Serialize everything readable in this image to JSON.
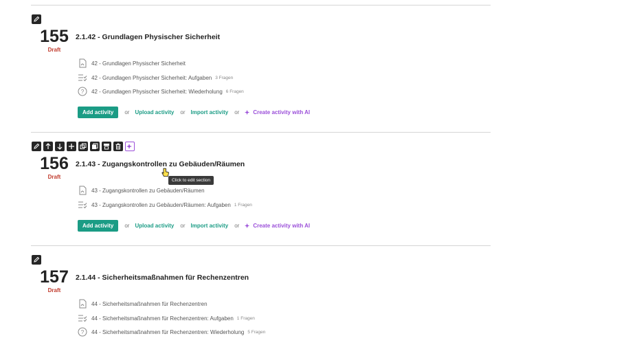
{
  "sections": [
    {
      "number": "155",
      "status": "Draft",
      "title": "2.1.42 - Grundlagen Physischer Sicherheit",
      "activities": [
        {
          "icon": "pdf-icon",
          "label": "42 - Grundlagen Physischer Sicherheit",
          "meta": ""
        },
        {
          "icon": "task-list-icon",
          "label": "42 - Grundlagen Physischer Sicherheit: Aufgaben",
          "meta": "3 Fragen"
        },
        {
          "icon": "question-icon",
          "label": "42 - Grundlagen Physischer Sicherheit: Wiederholung",
          "meta": "6 Fragen"
        }
      ]
    },
    {
      "number": "156",
      "status": "Draft",
      "title": "2.1.43 - Zugangskontrollen zu Gebäuden/Räumen",
      "activities": [
        {
          "icon": "pdf-icon",
          "label": "43 - Zugangskontrollen zu Gebäuden/Räumen",
          "meta": ""
        },
        {
          "icon": "task-list-icon",
          "label": "43 - Zugangskontrollen zu Gebäuden/Räumen: Aufgaben",
          "meta": "1 Fragen"
        }
      ]
    },
    {
      "number": "157",
      "status": "Draft",
      "title": "2.1.44 - Sicherheitsmaßnahmen für Rechenzentren",
      "activities": [
        {
          "icon": "pdf-icon",
          "label": "44 - Sicherheitsmaßnahmen für Rechenzentren",
          "meta": ""
        },
        {
          "icon": "task-list-icon",
          "label": "44 - Sicherheitsmaßnahmen für Rechenzentren: Aufgaben",
          "meta": "1 Fragen"
        },
        {
          "icon": "question-icon",
          "label": "44 - Sicherheitsmaßnahmen für Rechenzentren: Wiederholung",
          "meta": "5 Fragen"
        }
      ]
    }
  ],
  "actions": {
    "add": "Add activity",
    "or": "or",
    "upload": "Upload activity",
    "import": "Import activity",
    "ai": "Create activity with AI"
  },
  "tooltip": "Click to edit section",
  "colors": {
    "accent": "#1b9c85",
    "draft": "#c0392b",
    "ai": "#9b4fd9"
  }
}
